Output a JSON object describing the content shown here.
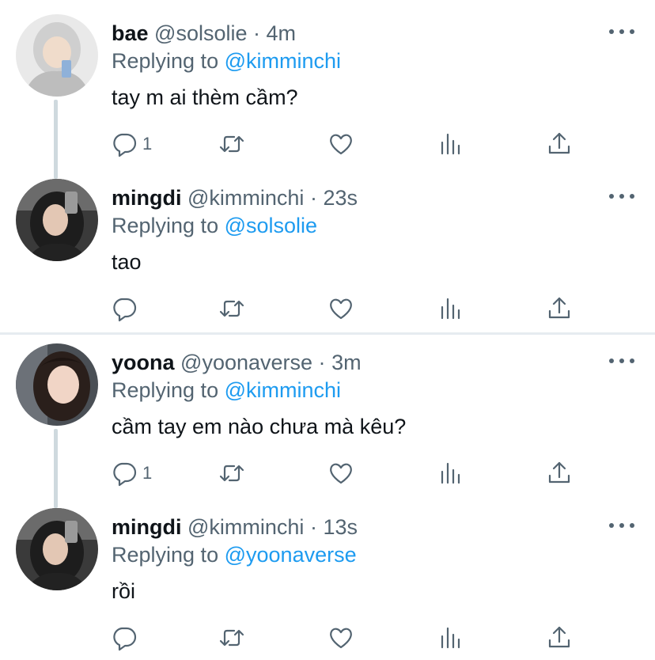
{
  "colors": {
    "primary_text": "#0f1419",
    "secondary_text": "#536471",
    "link": "#1d9bf0",
    "thread_line": "#cfd9de",
    "separator": "#e6ecf0"
  },
  "icons": {
    "reply": "reply-icon",
    "retweet": "retweet-icon",
    "like": "like-icon",
    "views": "views-icon",
    "share": "share-icon",
    "more": "more-icon"
  },
  "replying_label": "Replying to",
  "tweets": [
    {
      "name": "bae",
      "handle": "@solsolie",
      "separator": "·",
      "time": "4m",
      "replying_to": "@kimminchi",
      "text": "tay m ai thèm cầm?",
      "reply_count": "1"
    },
    {
      "name": "mingdi",
      "handle": "@kimminchi",
      "separator": "·",
      "time": "23s",
      "replying_to": "@solsolie",
      "text": "tao",
      "reply_count": ""
    },
    {
      "name": "yoona",
      "handle": "@yoonaverse",
      "separator": "·",
      "time": "3m",
      "replying_to": "@kimminchi",
      "text": "cầm tay em nào chưa mà kêu?",
      "reply_count": "1"
    },
    {
      "name": "mingdi",
      "handle": "@kimminchi",
      "separator": "·",
      "time": "13s",
      "replying_to": "@yoonaverse",
      "text": "rồi",
      "reply_count": ""
    }
  ]
}
